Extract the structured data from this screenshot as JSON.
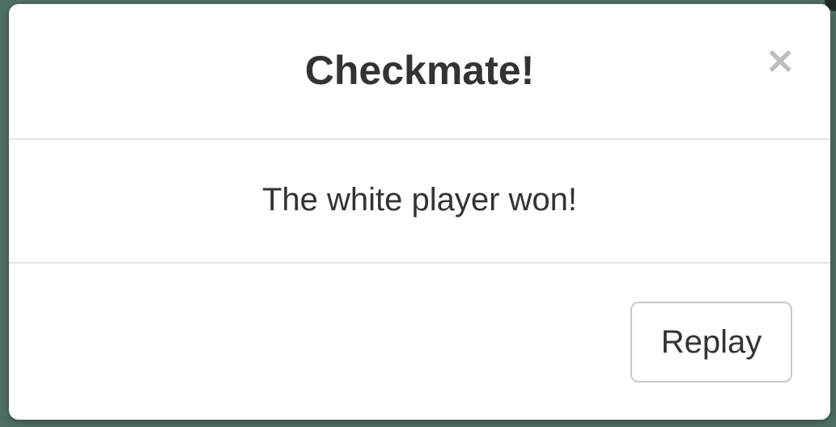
{
  "modal": {
    "title": "Checkmate!",
    "message": "The white player won!",
    "close_glyph": "×",
    "close_icon": "close-icon",
    "replay_label": "Replay"
  },
  "colors": {
    "backdrop": "#4f6e62",
    "modal_bg": "#ffffff",
    "title_text": "#333333",
    "close_icon": "#bdbdbd",
    "divider": "#e3e3e3",
    "button_border": "#c9c9c9"
  }
}
